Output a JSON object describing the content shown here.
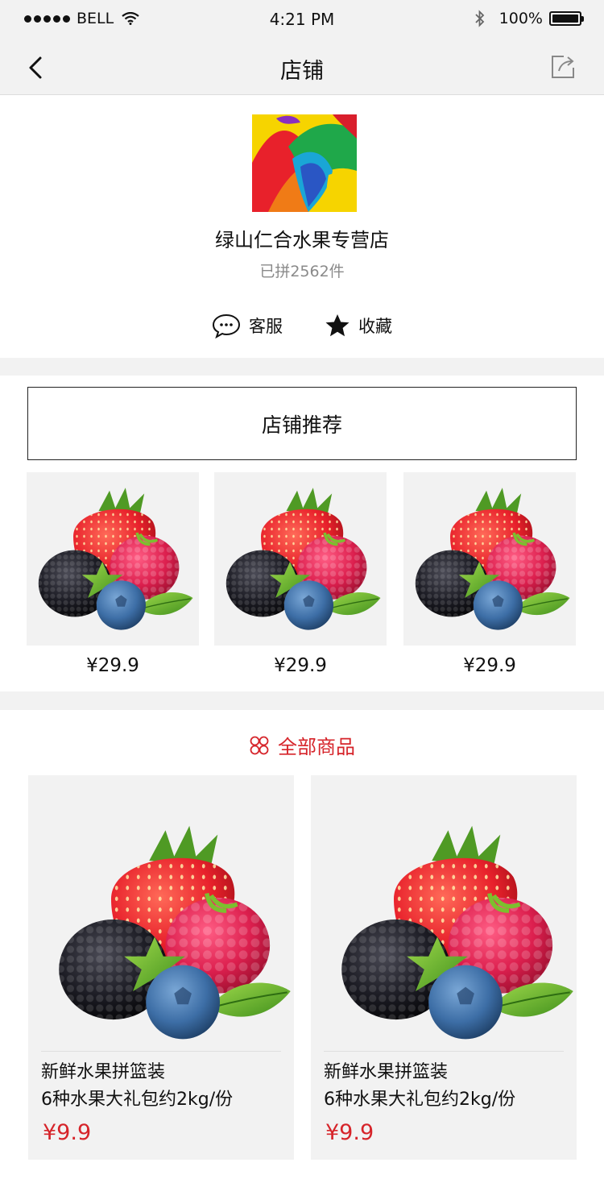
{
  "status_bar": {
    "carrier": "BELL",
    "time": "4:21 PM",
    "battery": "100%"
  },
  "nav": {
    "title": "店铺",
    "back_icon": "chevron-left-icon",
    "share_icon": "share-icon"
  },
  "store": {
    "name": "绿山仁合水果专营店",
    "sales": "已拼2562件",
    "actions": [
      {
        "label": "客服",
        "icon": "chat-bubble-icon"
      },
      {
        "label": "收藏",
        "icon": "star-icon"
      }
    ]
  },
  "recommend": {
    "title": "店铺推荐",
    "items": [
      {
        "price": "¥29.9"
      },
      {
        "price": "¥29.9"
      },
      {
        "price": "¥29.9"
      }
    ]
  },
  "all_products": {
    "title": "全部商品",
    "icon": "four-petal-icon",
    "items": [
      {
        "name_line1": "新鲜水果拼篮装",
        "name_line2": "6种水果大礼包约2kg/份",
        "price": "¥9.9"
      },
      {
        "name_line1": "新鲜水果拼篮装",
        "name_line2": "6种水果大礼包约2kg/份",
        "price": "¥9.9"
      }
    ]
  },
  "colors": {
    "accent_red": "#d6242a",
    "bar_gray": "#f2f2f2",
    "muted_text": "#8a8a8a"
  }
}
